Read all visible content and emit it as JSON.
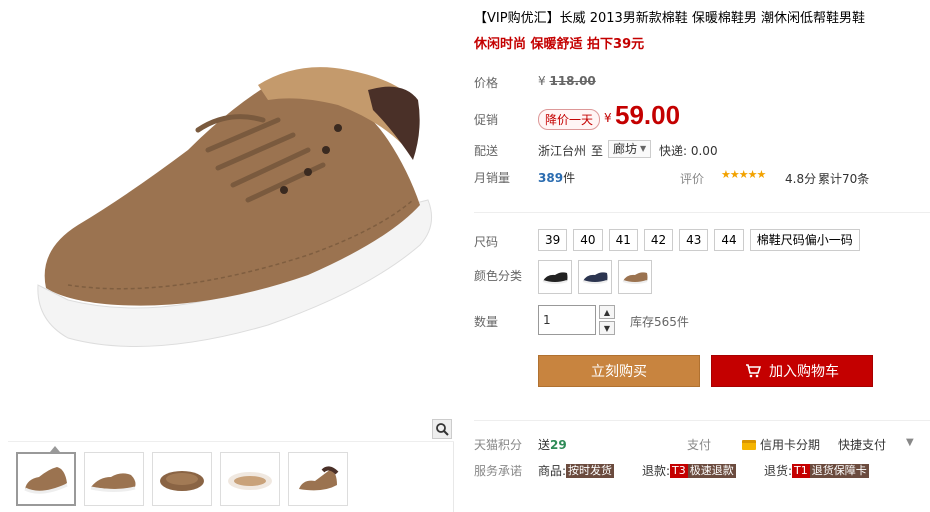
{
  "product": {
    "title": "【VIP购优汇】长威 2013男新款棉鞋 保暖棉鞋男 潮休闲低帮鞋男鞋",
    "subtitle": "休闲时尚 保暖舒适 拍下39元"
  },
  "price": {
    "label": "价格",
    "currency": "¥",
    "original": "118.00"
  },
  "promo": {
    "label": "促销",
    "badge": "降价一天",
    "currency": "¥",
    "price": "59.00"
  },
  "shipping": {
    "label": "配送",
    "from": "浙江台州",
    "to_prefix": "至",
    "to_city": "廊坊",
    "fee": "快递: 0.00"
  },
  "sales": {
    "label": "月销量",
    "count": "389",
    "unit": "件",
    "rating_label": "评价",
    "stars": "★★★★★",
    "rating": "4.8分",
    "reviews": "累计70条"
  },
  "size": {
    "label": "尺码",
    "options": [
      "39",
      "40",
      "41",
      "42",
      "43",
      "44",
      "棉鞋尺码偏小一码"
    ]
  },
  "color": {
    "label": "颜色分类",
    "options": [
      "black-shoe",
      "navy-shoe",
      "brown-shoe"
    ]
  },
  "quantity": {
    "label": "数量",
    "value": "1",
    "stock": "库存565件"
  },
  "actions": {
    "buy_now": "立刻购买",
    "add_to_cart": "加入购物车"
  },
  "benefits": {
    "points_label": "天猫积分",
    "points_prefix": "送",
    "points_value": "29",
    "pay_label": "支付",
    "credit": "信用卡分期",
    "quickpay": "快捷支付"
  },
  "service": {
    "label": "服务承诺",
    "items": [
      {
        "prefix": "商品:",
        "tag": "按时发货"
      },
      {
        "prefix": "退款:",
        "tag_t": "T3",
        "tag": "极速退款"
      },
      {
        "prefix": "退货:",
        "tag_t": "T1",
        "tag": "退货保障卡"
      }
    ]
  },
  "colors": {
    "accent_red": "#c40000",
    "buy_orange": "#c8843f",
    "shoe_brown": "#9b7350"
  }
}
